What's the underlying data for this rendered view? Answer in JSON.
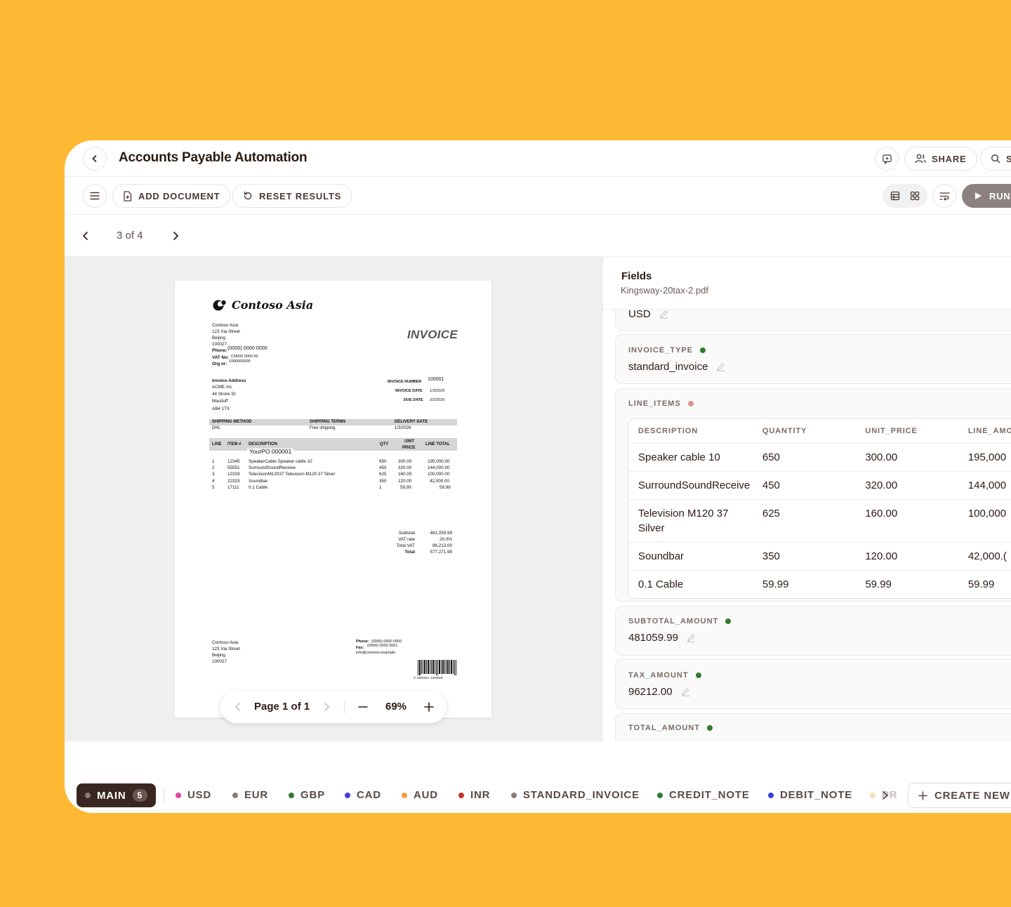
{
  "header": {
    "title": "Accounts Payable Automation",
    "share_label": "SHARE",
    "search_label": "S"
  },
  "toolbar": {
    "add_document": "ADD DOCUMENT",
    "reset_results": "RESET RESULTS",
    "run": "RUN"
  },
  "pager": {
    "text": "3 of 4"
  },
  "invoice": {
    "company": "Contoso Asia",
    "title": "INVOICE",
    "sender_lines": [
      "Contoso Asia",
      "123 Xia Street",
      "Beijing",
      "100027"
    ],
    "phone_label": "Phone:",
    "phone": "(0000) 0000 0000",
    "vat_label": "VAT No:",
    "vat": "CN000 0000 00",
    "org_label": "Org nr:",
    "org": "1000000000",
    "address_title": "Invoice Address",
    "address_lines": [
      "ACME Inc",
      "44 Shore St",
      "Macduff",
      "AB4 1TX"
    ],
    "invoice_number_label": "INVOICE NUMBER",
    "invoice_number": "100001",
    "invoice_date_label": "INVOICE DATE",
    "invoice_date": "1/3/2026",
    "due_date_label": "DUE DATE",
    "due_date": "2/2/2026",
    "shipping_method_label": "SHIPPING METHOD",
    "shipping_method": "DHL",
    "shipping_terms_label": "SHIPPING TERMS",
    "shipping_terms": "Free shipping.",
    "delivery_date_label": "DELIVERY DATE",
    "delivery_date": "1/3/2026",
    "col_line": "LINE",
    "col_item": "ITEM #",
    "col_desc": "DESCRIPTION",
    "col_qty": "QTY",
    "col_unit1": "UNIT",
    "col_unit2": "PRICE",
    "col_total": "LINE TOTAL",
    "po": "YourPO 000001",
    "lines": [
      {
        "line": "1",
        "item": "12345",
        "desc": "SpeakerCable Speaker cable 10",
        "qty": "650",
        "price": "300.00",
        "total": "195,000.00"
      },
      {
        "line": "2",
        "item": "55551",
        "desc": "SurroundSoundReceive",
        "qty": "450",
        "price": "320.00",
        "total": "144,000.00"
      },
      {
        "line": "3",
        "item": "12333",
        "desc": "TelevisionM12037 Television M120 37 Silver",
        "qty": "625",
        "price": "160.00",
        "total": "100,000.00"
      },
      {
        "line": "4",
        "item": "22333",
        "desc": "Soundbar",
        "qty": "350",
        "price": "120.00",
        "total": "42,000.00"
      },
      {
        "line": "5",
        "item": "17111",
        "desc": "0.1 Cable",
        "qty": "1",
        "price": "59.99",
        "total": "59.99"
      }
    ],
    "subtotal_label": "Subtotal",
    "subtotal": "481,059.99",
    "vat_rate_label": "VAT rate",
    "vat_rate": "20.0%",
    "total_vat_label": "Total VAT",
    "total_vat": "96,212.00",
    "total_label": "Total",
    "total": "577,271.99",
    "footer_lines": [
      "Contoso Asia",
      "123 Xia Street",
      "Beijing",
      "100027"
    ],
    "footer_phone_label": "Phone:",
    "footer_phone": "(0000) 0000 0000",
    "footer_fax_label": "Fax:",
    "footer_fax": "(0000) 0000 0001",
    "footer_email": "info@contoso.example",
    "barcode_text": "0 060052 180808"
  },
  "zoom": {
    "page_label": "Page 1 of 1",
    "percent": "69%"
  },
  "panel": {
    "title": "Fields",
    "filename": "Kingsway-20tax-2.pdf",
    "currency_value": "USD",
    "invoice_type": {
      "label": "INVOICE_TYPE",
      "value": "standard_invoice",
      "status_color": "#2e7d32"
    },
    "line_items": {
      "label": "LINE_ITEMS",
      "status_color": "#d9968a",
      "columns": [
        "DESCRIPTION",
        "QUANTITY",
        "UNIT_PRICE",
        "LINE_AMO"
      ],
      "rows": [
        [
          "Speaker cable 10",
          "650",
          "300.00",
          "195,000"
        ],
        [
          "SurroundSoundReceive",
          "450",
          "320.00",
          "144,000"
        ],
        [
          "Television M120 37 Silver",
          "625",
          "160.00",
          "100,000"
        ],
        [
          "Soundbar",
          "350",
          "120.00",
          "42,000.("
        ],
        [
          "0.1 Cable",
          "59.99",
          "59.99",
          "59.99"
        ]
      ]
    },
    "subtotal_amount": {
      "label": "SUBTOTAL_AMOUNT",
      "value": "481059.99",
      "status_color": "#2e7d32"
    },
    "tax_amount": {
      "label": "TAX_AMOUNT",
      "value": "96212.00",
      "status_color": "#2e7d32"
    },
    "total_amount": {
      "label": "TOTAL_AMOUNT",
      "status_color": "#2e7d32"
    }
  },
  "tabs": {
    "main": {
      "label": "MAIN",
      "count": "5"
    },
    "tags": [
      {
        "label": "USD",
        "color": "#e0479e"
      },
      {
        "label": "EUR",
        "color": "#8a7a73"
      },
      {
        "label": "GBP",
        "color": "#2e7d32"
      },
      {
        "label": "CAD",
        "color": "#3f3fd9"
      },
      {
        "label": "AUD",
        "color": "#f0a040"
      },
      {
        "label": "INR",
        "color": "#c0392b"
      },
      {
        "label": "STANDARD_INVOICE",
        "color": "#8a7a73"
      },
      {
        "label": "CREDIT_NOTE",
        "color": "#2e7d32"
      },
      {
        "label": "DEBIT_NOTE",
        "color": "#3f3fd9"
      },
      {
        "label": "PR",
        "color": "#f0a040"
      }
    ],
    "create_new": "CREATE NEW"
  }
}
